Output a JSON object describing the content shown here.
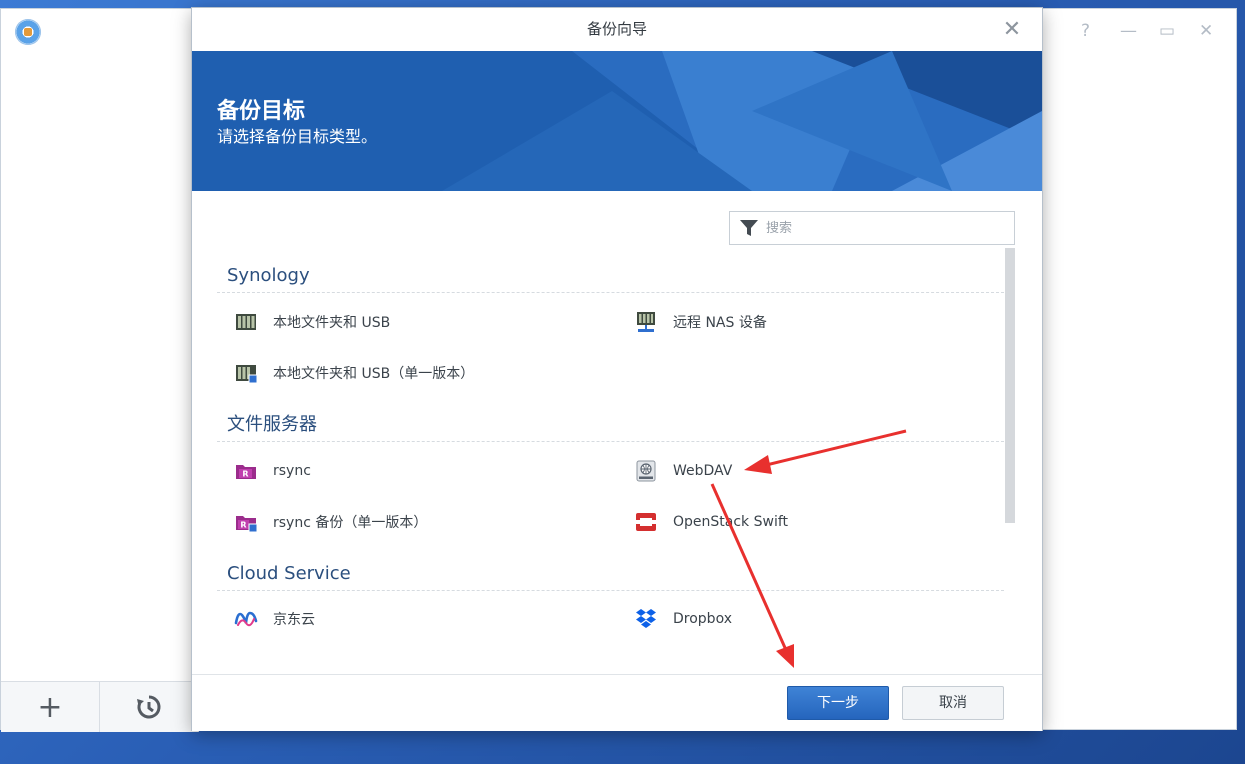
{
  "background_window": {
    "controls": {
      "help": "?",
      "minimize": "—",
      "maximize": "▭",
      "close": "✕"
    },
    "bottom_bar": {
      "add": "+",
      "history": "↺"
    }
  },
  "dialog": {
    "title": "备份向导",
    "close": "✕",
    "banner": {
      "title": "备份目标",
      "subtitle": "请选择备份目标类型。"
    },
    "search": {
      "placeholder": "搜索",
      "value": ""
    },
    "sections": [
      {
        "name": "Synology",
        "items": [
          {
            "label": "本地文件夹和 USB",
            "icon": "local-storage-icon"
          },
          {
            "label": "远程 NAS 设备",
            "icon": "remote-nas-icon"
          },
          {
            "label": "本地文件夹和 USB（单一版本）",
            "icon": "local-storage-single-version-icon"
          }
        ]
      },
      {
        "name": "文件服务器",
        "items": [
          {
            "label": "rsync",
            "icon": "rsync-icon"
          },
          {
            "label": "WebDAV",
            "icon": "webdav-icon"
          },
          {
            "label": "rsync 备份（单一版本）",
            "icon": "rsync-single-version-icon"
          },
          {
            "label": "OpenStack Swift",
            "icon": "openstack-swift-icon"
          }
        ]
      },
      {
        "name": "Cloud Service",
        "items": [
          {
            "label": "京东云",
            "icon": "jdcloud-icon"
          },
          {
            "label": "Dropbox",
            "icon": "dropbox-icon"
          }
        ]
      }
    ],
    "footer": {
      "next": "下一步",
      "cancel": "取消"
    }
  },
  "colors": {
    "primary_button": "#2565bd",
    "banner": "#1f5fb0",
    "section_header": "#2b4f7e",
    "annotation_arrow": "#e8302e"
  }
}
